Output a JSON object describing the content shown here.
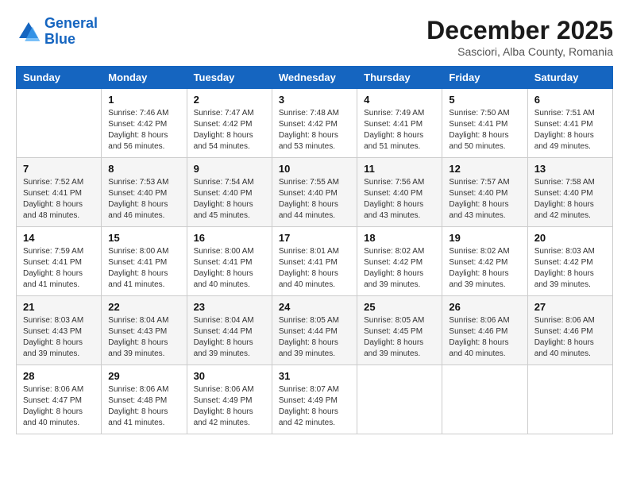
{
  "logo": {
    "line1": "General",
    "line2": "Blue"
  },
  "title": "December 2025",
  "subtitle": "Sasciori, Alba County, Romania",
  "weekdays": [
    "Sunday",
    "Monday",
    "Tuesday",
    "Wednesday",
    "Thursday",
    "Friday",
    "Saturday"
  ],
  "weeks": [
    [
      {
        "day": "",
        "sunrise": "",
        "sunset": "",
        "daylight": ""
      },
      {
        "day": "1",
        "sunrise": "Sunrise: 7:46 AM",
        "sunset": "Sunset: 4:42 PM",
        "daylight": "Daylight: 8 hours and 56 minutes."
      },
      {
        "day": "2",
        "sunrise": "Sunrise: 7:47 AM",
        "sunset": "Sunset: 4:42 PM",
        "daylight": "Daylight: 8 hours and 54 minutes."
      },
      {
        "day": "3",
        "sunrise": "Sunrise: 7:48 AM",
        "sunset": "Sunset: 4:42 PM",
        "daylight": "Daylight: 8 hours and 53 minutes."
      },
      {
        "day": "4",
        "sunrise": "Sunrise: 7:49 AM",
        "sunset": "Sunset: 4:41 PM",
        "daylight": "Daylight: 8 hours and 51 minutes."
      },
      {
        "day": "5",
        "sunrise": "Sunrise: 7:50 AM",
        "sunset": "Sunset: 4:41 PM",
        "daylight": "Daylight: 8 hours and 50 minutes."
      },
      {
        "day": "6",
        "sunrise": "Sunrise: 7:51 AM",
        "sunset": "Sunset: 4:41 PM",
        "daylight": "Daylight: 8 hours and 49 minutes."
      }
    ],
    [
      {
        "day": "7",
        "sunrise": "Sunrise: 7:52 AM",
        "sunset": "Sunset: 4:41 PM",
        "daylight": "Daylight: 8 hours and 48 minutes."
      },
      {
        "day": "8",
        "sunrise": "Sunrise: 7:53 AM",
        "sunset": "Sunset: 4:40 PM",
        "daylight": "Daylight: 8 hours and 46 minutes."
      },
      {
        "day": "9",
        "sunrise": "Sunrise: 7:54 AM",
        "sunset": "Sunset: 4:40 PM",
        "daylight": "Daylight: 8 hours and 45 minutes."
      },
      {
        "day": "10",
        "sunrise": "Sunrise: 7:55 AM",
        "sunset": "Sunset: 4:40 PM",
        "daylight": "Daylight: 8 hours and 44 minutes."
      },
      {
        "day": "11",
        "sunrise": "Sunrise: 7:56 AM",
        "sunset": "Sunset: 4:40 PM",
        "daylight": "Daylight: 8 hours and 43 minutes."
      },
      {
        "day": "12",
        "sunrise": "Sunrise: 7:57 AM",
        "sunset": "Sunset: 4:40 PM",
        "daylight": "Daylight: 8 hours and 43 minutes."
      },
      {
        "day": "13",
        "sunrise": "Sunrise: 7:58 AM",
        "sunset": "Sunset: 4:40 PM",
        "daylight": "Daylight: 8 hours and 42 minutes."
      }
    ],
    [
      {
        "day": "14",
        "sunrise": "Sunrise: 7:59 AM",
        "sunset": "Sunset: 4:41 PM",
        "daylight": "Daylight: 8 hours and 41 minutes."
      },
      {
        "day": "15",
        "sunrise": "Sunrise: 8:00 AM",
        "sunset": "Sunset: 4:41 PM",
        "daylight": "Daylight: 8 hours and 41 minutes."
      },
      {
        "day": "16",
        "sunrise": "Sunrise: 8:00 AM",
        "sunset": "Sunset: 4:41 PM",
        "daylight": "Daylight: 8 hours and 40 minutes."
      },
      {
        "day": "17",
        "sunrise": "Sunrise: 8:01 AM",
        "sunset": "Sunset: 4:41 PM",
        "daylight": "Daylight: 8 hours and 40 minutes."
      },
      {
        "day": "18",
        "sunrise": "Sunrise: 8:02 AM",
        "sunset": "Sunset: 4:42 PM",
        "daylight": "Daylight: 8 hours and 39 minutes."
      },
      {
        "day": "19",
        "sunrise": "Sunrise: 8:02 AM",
        "sunset": "Sunset: 4:42 PM",
        "daylight": "Daylight: 8 hours and 39 minutes."
      },
      {
        "day": "20",
        "sunrise": "Sunrise: 8:03 AM",
        "sunset": "Sunset: 4:42 PM",
        "daylight": "Daylight: 8 hours and 39 minutes."
      }
    ],
    [
      {
        "day": "21",
        "sunrise": "Sunrise: 8:03 AM",
        "sunset": "Sunset: 4:43 PM",
        "daylight": "Daylight: 8 hours and 39 minutes."
      },
      {
        "day": "22",
        "sunrise": "Sunrise: 8:04 AM",
        "sunset": "Sunset: 4:43 PM",
        "daylight": "Daylight: 8 hours and 39 minutes."
      },
      {
        "day": "23",
        "sunrise": "Sunrise: 8:04 AM",
        "sunset": "Sunset: 4:44 PM",
        "daylight": "Daylight: 8 hours and 39 minutes."
      },
      {
        "day": "24",
        "sunrise": "Sunrise: 8:05 AM",
        "sunset": "Sunset: 4:44 PM",
        "daylight": "Daylight: 8 hours and 39 minutes."
      },
      {
        "day": "25",
        "sunrise": "Sunrise: 8:05 AM",
        "sunset": "Sunset: 4:45 PM",
        "daylight": "Daylight: 8 hours and 39 minutes."
      },
      {
        "day": "26",
        "sunrise": "Sunrise: 8:06 AM",
        "sunset": "Sunset: 4:46 PM",
        "daylight": "Daylight: 8 hours and 40 minutes."
      },
      {
        "day": "27",
        "sunrise": "Sunrise: 8:06 AM",
        "sunset": "Sunset: 4:46 PM",
        "daylight": "Daylight: 8 hours and 40 minutes."
      }
    ],
    [
      {
        "day": "28",
        "sunrise": "Sunrise: 8:06 AM",
        "sunset": "Sunset: 4:47 PM",
        "daylight": "Daylight: 8 hours and 40 minutes."
      },
      {
        "day": "29",
        "sunrise": "Sunrise: 8:06 AM",
        "sunset": "Sunset: 4:48 PM",
        "daylight": "Daylight: 8 hours and 41 minutes."
      },
      {
        "day": "30",
        "sunrise": "Sunrise: 8:06 AM",
        "sunset": "Sunset: 4:49 PM",
        "daylight": "Daylight: 8 hours and 42 minutes."
      },
      {
        "day": "31",
        "sunrise": "Sunrise: 8:07 AM",
        "sunset": "Sunset: 4:49 PM",
        "daylight": "Daylight: 8 hours and 42 minutes."
      },
      {
        "day": "",
        "sunrise": "",
        "sunset": "",
        "daylight": ""
      },
      {
        "day": "",
        "sunrise": "",
        "sunset": "",
        "daylight": ""
      },
      {
        "day": "",
        "sunrise": "",
        "sunset": "",
        "daylight": ""
      }
    ]
  ]
}
